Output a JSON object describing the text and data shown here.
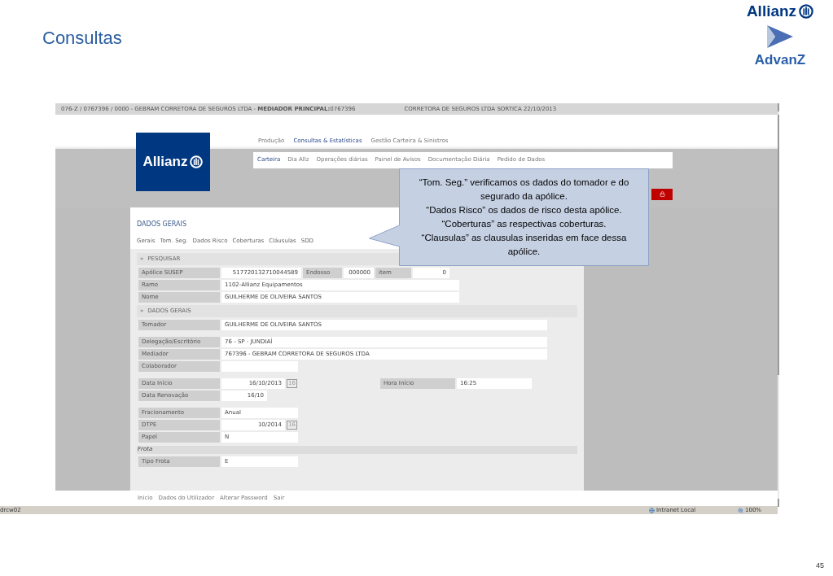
{
  "slide": {
    "title": "Consultas",
    "logo_top": "Allianz",
    "logo_bottom": "AdvanZ",
    "page_number": "45"
  },
  "browser": {
    "top_bar": {
      "left": "076-Z / 0767396 / 0000 - GEBRAM CORRETORA DE SEGUROS LTDA - **MEDIADOR PRINCIPAL:**0767396",
      "right": "CORRETORA DE SEGUROS LTDA SORTICA 22/10/2013"
    },
    "logo": "Allianz",
    "menu": [
      {
        "label": "Produção",
        "selected": false
      },
      {
        "label": "Consultas & Estatísticas",
        "selected": true
      },
      {
        "label": "Gestão Carteira & Sinistros",
        "selected": false
      }
    ],
    "submenu": [
      {
        "label": "Carteira",
        "selected": true
      },
      {
        "label": "Dia Allz",
        "selected": false
      },
      {
        "label": "Operações diárias",
        "selected": false
      },
      {
        "label": "Painel de Avisos",
        "selected": false
      },
      {
        "label": "Documentação Diária",
        "selected": false
      },
      {
        "label": "Pedido de Dados",
        "selected": false
      }
    ],
    "panel_title": "DADOS GERAIS",
    "tabs": [
      "Gerais",
      "Tom. Seg.",
      "Dados Risco",
      "Coberturas",
      "Cláusulas",
      "SDD"
    ],
    "sections": [
      {
        "title": "PESQUISAR",
        "kind": "section",
        "icon": "»",
        "groups": [
          [
            {
              "fields": [
                {
                  "label": "Apólice SUSEP",
                  "value": "517720132710044589"
                },
                {
                  "label": "Endosso",
                  "value": "000000"
                },
                {
                  "label": "item",
                  "value": "0"
                }
              ]
            },
            {
              "fields": [
                {
                  "label": "Ramo",
                  "value": "1102-Allianz Equipamentos"
                }
              ]
            },
            {
              "fields": [
                {
                  "label": "Nome",
                  "value": "GUILHERME DE OLIVEIRA SANTOS"
                }
              ]
            }
          ]
        ]
      },
      {
        "title": "DADOS GERAIS",
        "kind": "section",
        "icon": "»",
        "groups": [
          [
            {
              "fields": [
                {
                  "label": "Tomador",
                  "value": "GUILHERME DE OLIVEIRA SANTOS"
                }
              ]
            }
          ],
          [
            {
              "fields": [
                {
                  "label": "Delegação/Escritório",
                  "value": "76 - SP - JUNDIAÍ"
                }
              ]
            },
            {
              "fields": [
                {
                  "label": "Mediador",
                  "value": "767396 - GEBRAM CORRETORA DE SEGUROS LTDA"
                }
              ]
            },
            {
              "fields": [
                {
                  "label": "Colaborador"
                }
              ]
            }
          ],
          [
            {
              "fields": [
                {
                  "label": "Data Início",
                  "value": "16/10/2013",
                  "calendar": "16"
                },
                {
                  "label": "Hora Início",
                  "value": "16:25"
                }
              ]
            },
            {
              "fields": [
                {
                  "label": "Data Renovação",
                  "value": "16/10"
                }
              ]
            }
          ],
          [
            {
              "fields": [
                {
                  "label": "Fracionamento",
                  "value": "Anual"
                }
              ]
            },
            {
              "fields": [
                {
                  "label": "DTPE",
                  "value": "10/2014",
                  "calendar": "16"
                }
              ]
            },
            {
              "fields": [
                {
                  "label": "Papel",
                  "value": "N"
                }
              ]
            }
          ]
        ]
      },
      {
        "title": "Frota",
        "kind": "subsection",
        "groups": [
          [
            {
              "fields": [
                {
                  "label": "Tipo Frota",
                  "value": "E"
                }
              ]
            }
          ]
        ]
      }
    ],
    "footer_links": [
      "Inicio",
      "Dados do Utilizador",
      "Alterar Password",
      "Sair"
    ],
    "status_bar": {
      "left": "drcw02",
      "zone": "Intranet Local",
      "zoom": "100%"
    }
  },
  "callout": [
    "“Tom. Seg.” verificamos os dados do tomador e do segurado da apólice.",
    "“Dados Risco” os dados de risco desta apólice.",
    "“Coberturas” as respectivas coberturas.",
    "“Clausulas” as clausulas inseridas em face dessa apólice."
  ]
}
